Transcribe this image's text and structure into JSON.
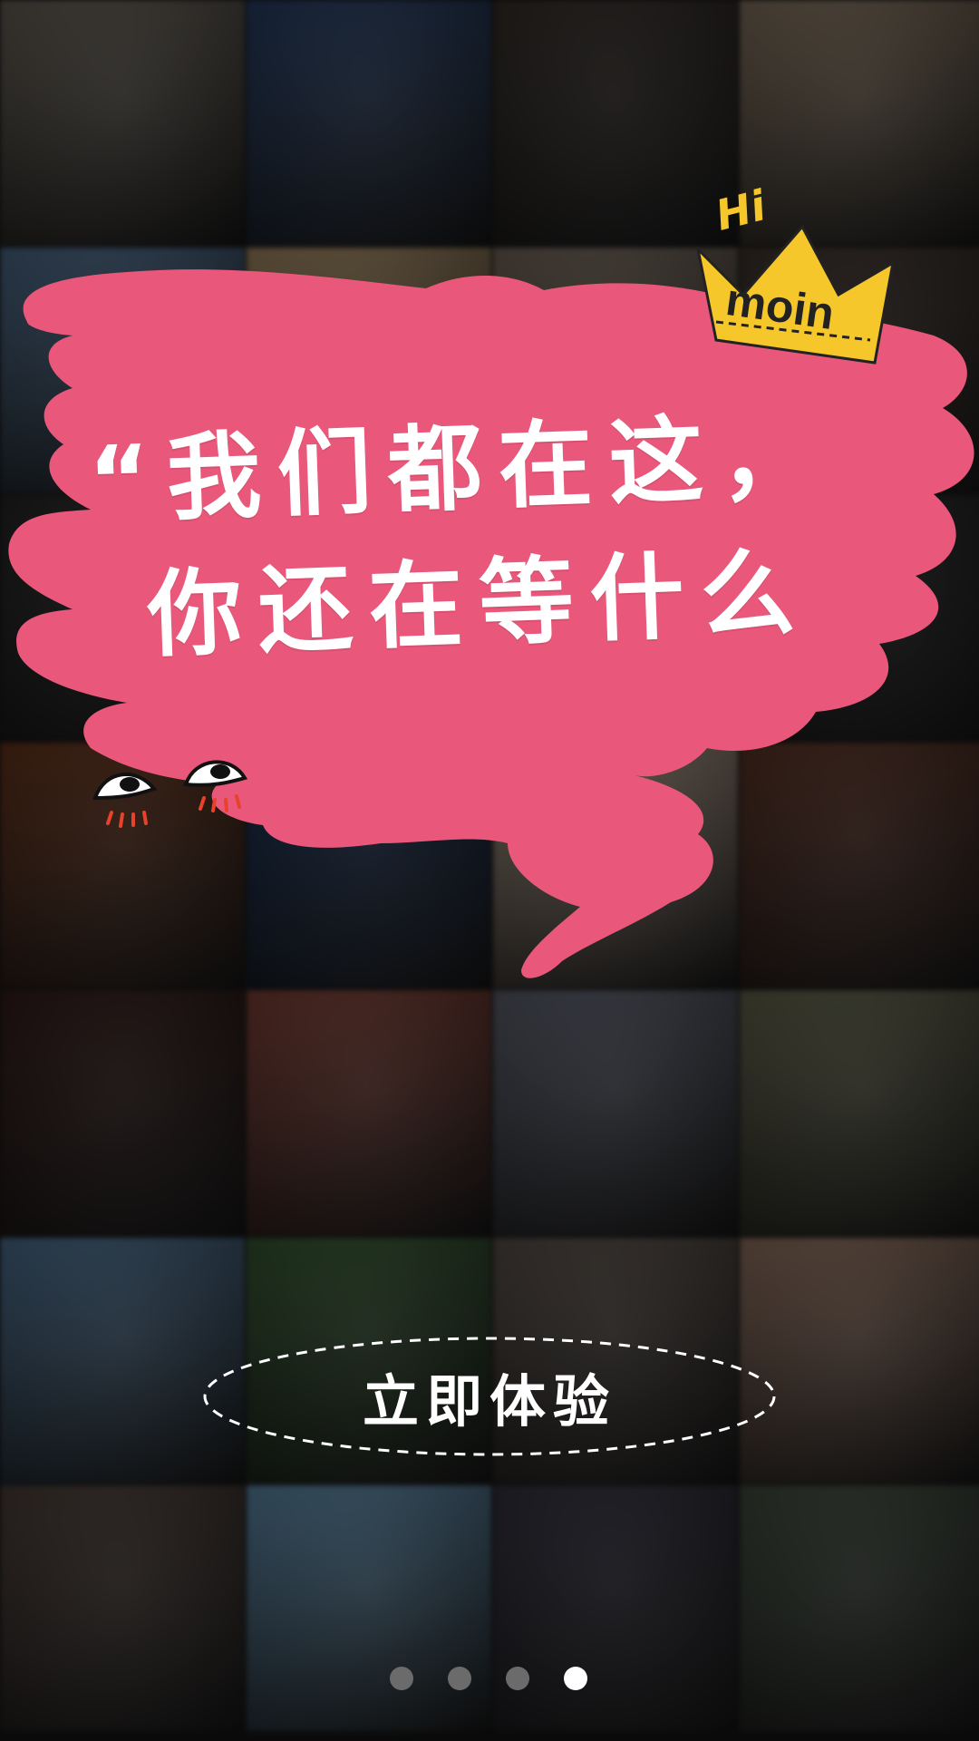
{
  "headline": {
    "line1": "“我们都在这，",
    "line2": "你还在等什么"
  },
  "badge": {
    "hi": "Hi",
    "brand": "moin"
  },
  "cta": {
    "label": "立即体验"
  },
  "pager": {
    "count": 4,
    "active_index": 3
  },
  "colors": {
    "bubble": "#e9587a",
    "crown": "#f5c72a",
    "text": "#ffffff",
    "dot_inactive": "#6b6b6b",
    "dot_active": "#ffffff"
  },
  "background_tiles": [
    {
      "subject": "woman-photo",
      "color": "#7c7468"
    },
    {
      "subject": "sky-airplane",
      "color": "#2c4a7a"
    },
    {
      "subject": "beethoven-portrait",
      "color": "#3d3530"
    },
    {
      "subject": "noodle-bowls",
      "color": "#a28c72"
    },
    {
      "subject": "comic-wow",
      "color": "#5a7fa8"
    },
    {
      "subject": "food-plate",
      "color": "#c9a777"
    },
    {
      "subject": "speech-bubble-photo",
      "color": "#8f7e6d"
    },
    {
      "subject": "bowl-dark",
      "color": "#4a3d34"
    },
    {
      "subject": "dark-photo",
      "color": "#2a2a2a"
    },
    {
      "subject": "dark-photo",
      "color": "#3a3030"
    },
    {
      "subject": "dark-photo",
      "color": "#4b3a3a"
    },
    {
      "subject": "dark-photo",
      "color": "#2e2e2e"
    },
    {
      "subject": "shrine-comic",
      "color": "#7a3b1e"
    },
    {
      "subject": "night-anime",
      "color": "#1d3a6a"
    },
    {
      "subject": "face-closeup",
      "color": "#d4bba5"
    },
    {
      "subject": "couple-photo",
      "color": "#6d3b2a"
    },
    {
      "subject": "night-lanterns",
      "color": "#3b1f1c"
    },
    {
      "subject": "family-dinner",
      "color": "#9a4b3e"
    },
    {
      "subject": "child-drinking",
      "color": "#6f7485"
    },
    {
      "subject": "girl-mustache",
      "color": "#77785a"
    },
    {
      "subject": "beach-girl",
      "color": "#5b87b0"
    },
    {
      "subject": "green-room",
      "color": "#3f6a3a"
    },
    {
      "subject": "boy-mask",
      "color": "#6c6058"
    },
    {
      "subject": "cat-lanterns",
      "color": "#b28a74"
    },
    {
      "subject": "woman-dress",
      "color": "#5a4a44"
    },
    {
      "subject": "spiderman-sticker",
      "color": "#6fa7cf"
    },
    {
      "subject": "captain-america",
      "color": "#3a3a4a"
    },
    {
      "subject": "man-cap",
      "color": "#4d5a4a"
    }
  ]
}
